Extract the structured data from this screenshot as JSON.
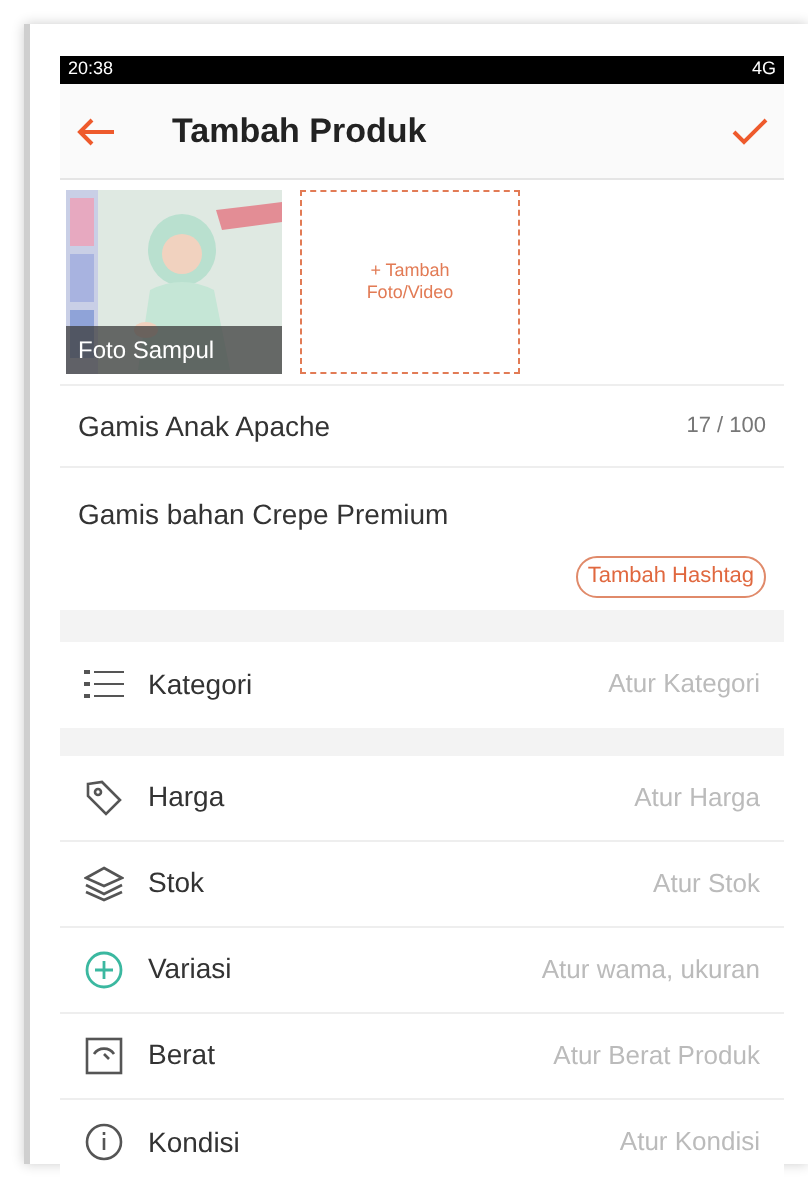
{
  "status_bar": {
    "time": "20:38",
    "network": "4G"
  },
  "header": {
    "title": "Tambah Produk"
  },
  "photos": {
    "cover": {
      "kind": "picture",
      "label": "Foto Sampul"
    },
    "add_label": "+ Tambah\nFoto/Video"
  },
  "name_field": {
    "value": "Gamis Anak Apache",
    "counter": "17 / 100"
  },
  "description_field": {
    "value": "Gamis bahan Crepe Premium",
    "hashtag_button": "Tambah Hashtag"
  },
  "category": {
    "kind": "list",
    "label": "Kategori",
    "value": "Atur Kategori"
  },
  "rows": [
    {
      "kind": "tag",
      "label": "Harga",
      "value": "Atur Harga"
    },
    {
      "kind": "layers",
      "label": "Stok",
      "value": "Atur Stok"
    },
    {
      "kind": "plus",
      "label": "Variasi",
      "value": "Atur wama, ukuran"
    },
    {
      "kind": "scale",
      "label": "Berat",
      "value": "Atur Berat Produk"
    },
    {
      "kind": "info",
      "label": "Kondisi",
      "value": "Atur Kondisi"
    }
  ]
}
